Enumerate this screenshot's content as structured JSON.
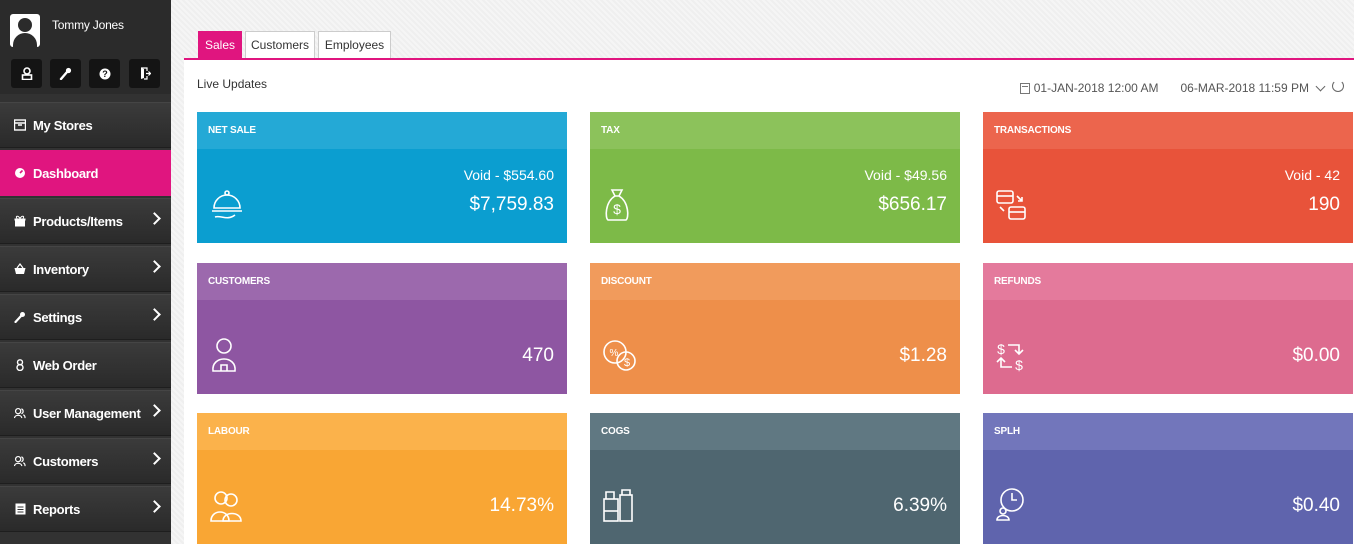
{
  "user": {
    "name": "Tommy Jones"
  },
  "toolbar_icons": [
    "user-icon",
    "wrench-icon",
    "help-icon",
    "logout-icon"
  ],
  "nav": [
    {
      "label": "My Stores",
      "icon": "store-icon",
      "chevron": false,
      "active": false
    },
    {
      "label": "Dashboard",
      "icon": "dashboard-icon",
      "chevron": false,
      "active": true
    },
    {
      "label": "Products/Items",
      "icon": "gift-icon",
      "chevron": true,
      "active": false
    },
    {
      "label": "Inventory",
      "icon": "basket-icon",
      "chevron": true,
      "active": false
    },
    {
      "label": "Settings",
      "icon": "wrench-icon",
      "chevron": true,
      "active": false
    },
    {
      "label": "Web Order",
      "icon": "person-icon",
      "chevron": false,
      "active": false
    },
    {
      "label": "User Management",
      "icon": "users-icon",
      "chevron": true,
      "active": false
    },
    {
      "label": "Customers",
      "icon": "users-icon",
      "chevron": true,
      "active": false
    },
    {
      "label": "Reports",
      "icon": "report-icon",
      "chevron": true,
      "active": false
    }
  ],
  "tabs": [
    {
      "label": "Sales",
      "active": true
    },
    {
      "label": "Customers",
      "active": false
    },
    {
      "label": "Employees",
      "active": false
    }
  ],
  "live": {
    "title": "Live Updates",
    "start_date": "01-JAN-2018 12:00 AM",
    "end_date": "06-MAR-2018 11:59 PM"
  },
  "cards": [
    {
      "title": "NET SALE",
      "sub": "Void - $554.60",
      "value": "$7,759.83",
      "icon": "serving-cloche-icon",
      "header_color": "#24a9d6",
      "body_color": "#0b9ed0"
    },
    {
      "title": "TAX",
      "sub": "Void - $49.56",
      "value": "$656.17",
      "icon": "money-bag-icon",
      "header_color": "#8cc25b",
      "body_color": "#7dba48"
    },
    {
      "title": "TRANSACTIONS",
      "sub": "Void - 42",
      "value": "190",
      "icon": "transactions-icon",
      "header_color": "#ec654d",
      "body_color": "#e8533a"
    },
    {
      "title": "CUSTOMERS",
      "sub": "",
      "value": "470",
      "icon": "customer-icon",
      "header_color": "#9c69ad",
      "body_color": "#8e56a2"
    },
    {
      "title": "DISCOUNT",
      "sub": "",
      "value": "$1.28",
      "icon": "discount-icon",
      "header_color": "#f19b5c",
      "body_color": "#ee8f4a"
    },
    {
      "title": "REFUNDS",
      "sub": "",
      "value": "$0.00",
      "icon": "refund-icon",
      "header_color": "#e47a9c",
      "body_color": "#dd6b8f"
    },
    {
      "title": "LABOUR",
      "sub": "",
      "value": "14.73%",
      "icon": "labour-icon",
      "header_color": "#fbb24b",
      "body_color": "#f9a634"
    },
    {
      "title": "COGS",
      "sub": "",
      "value": "6.39%",
      "icon": "cogs-icon",
      "header_color": "#607882",
      "body_color": "#4f6670"
    },
    {
      "title": "SPLH",
      "sub": "",
      "value": "$0.40",
      "icon": "clock-person-icon",
      "header_color": "#7276bb",
      "body_color": "#5f64ad"
    }
  ]
}
